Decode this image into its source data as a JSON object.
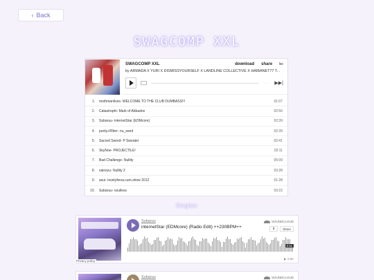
{
  "nav": {
    "back_label": "Back"
  },
  "page": {
    "title": "SWAGCOMP XXL"
  },
  "player": {
    "album_title": "SWAGCOMP XXL",
    "byline": "by ARMADA X YURI X DISMISSYOURSELF X LANDLINE COLLECTIVE X HAIBANET77 T...",
    "download_label": "download",
    "share_label": "share",
    "brand": "bc",
    "tracks": [
      {
        "num": "1.",
        "name": "mothmanlives- WELCOME TO THE CLUB DUMBASS!!!",
        "dur": "01:07"
      },
      {
        "num": "2.",
        "name": "Catastrophi- Mark of Abbadon",
        "dur": "02:56"
      },
      {
        "num": "3.",
        "name": "Subaruu- internetStar (EDMcore)",
        "dur": "02:39"
      },
      {
        "num": "4.",
        "name": "purity.r/Riter- nu_seed",
        "dur": "02:39"
      },
      {
        "num": "5.",
        "name": "Sacred Sword- P Sweater",
        "dur": "02:41"
      },
      {
        "num": "6.",
        "name": "SkyNoe- PROJECTILE!",
        "dur": "02:11"
      },
      {
        "num": "7.",
        "name": "Bad Challenge- Nullity",
        "dur": "05:09"
      },
      {
        "num": "8.",
        "name": "vainszu- Nullity 2",
        "dur": "03:28"
      },
      {
        "num": "9.",
        "name": "azui- lovely4eva.cum.show 2012",
        "dur": "01:28"
      },
      {
        "num": "10.",
        "name": "Subaruu- soulless",
        "dur": "03:22"
      }
    ]
  },
  "singles": {
    "heading": "Singles:",
    "cards": [
      {
        "artist": "Subaruu",
        "title": "internetStar (EDMcore) (Radio Edit) ++230BPM++",
        "brand": "SOUNDCLOUD",
        "share_label": "Share",
        "time_badge": "2:11",
        "plays": "▶ 3.8K"
      },
      {
        "artist": "Subaruu",
        "brand": "SOUNDCLOUD"
      }
    ],
    "privacy_label": "Privacy policy"
  }
}
